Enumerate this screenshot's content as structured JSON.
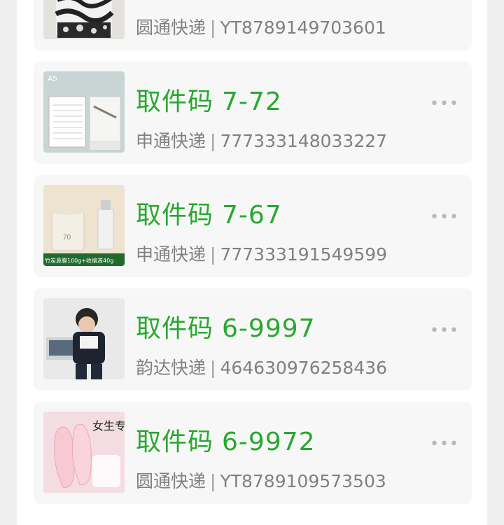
{
  "parcels": [
    {
      "courier": "圆通快递",
      "tracking": "YT8789149703601",
      "label": "",
      "code": ""
    },
    {
      "label": "取件码",
      "code": "7-72",
      "courier": "申通快递",
      "tracking": "777333148033227"
    },
    {
      "label": "取件码",
      "code": "7-67",
      "courier": "申通快递",
      "tracking": "777333191549599",
      "thumb_text": "竹炭鼻膜100g+收缩液40g"
    },
    {
      "label": "取件码",
      "code": "6-9997",
      "courier": "韵达快递",
      "tracking": "464630976258436"
    },
    {
      "label": "取件码",
      "code": "6-9972",
      "courier": "圆通快递",
      "tracking": "YT8789109573503",
      "thumb_text": "女生专用"
    }
  ],
  "separator": "|",
  "more_icon": "more-dots-icon",
  "colors": {
    "pickup_code": "#27a82f",
    "meta_text": "#808080",
    "card_bg": "#f7f7f7",
    "page_bg": "#efefef"
  }
}
